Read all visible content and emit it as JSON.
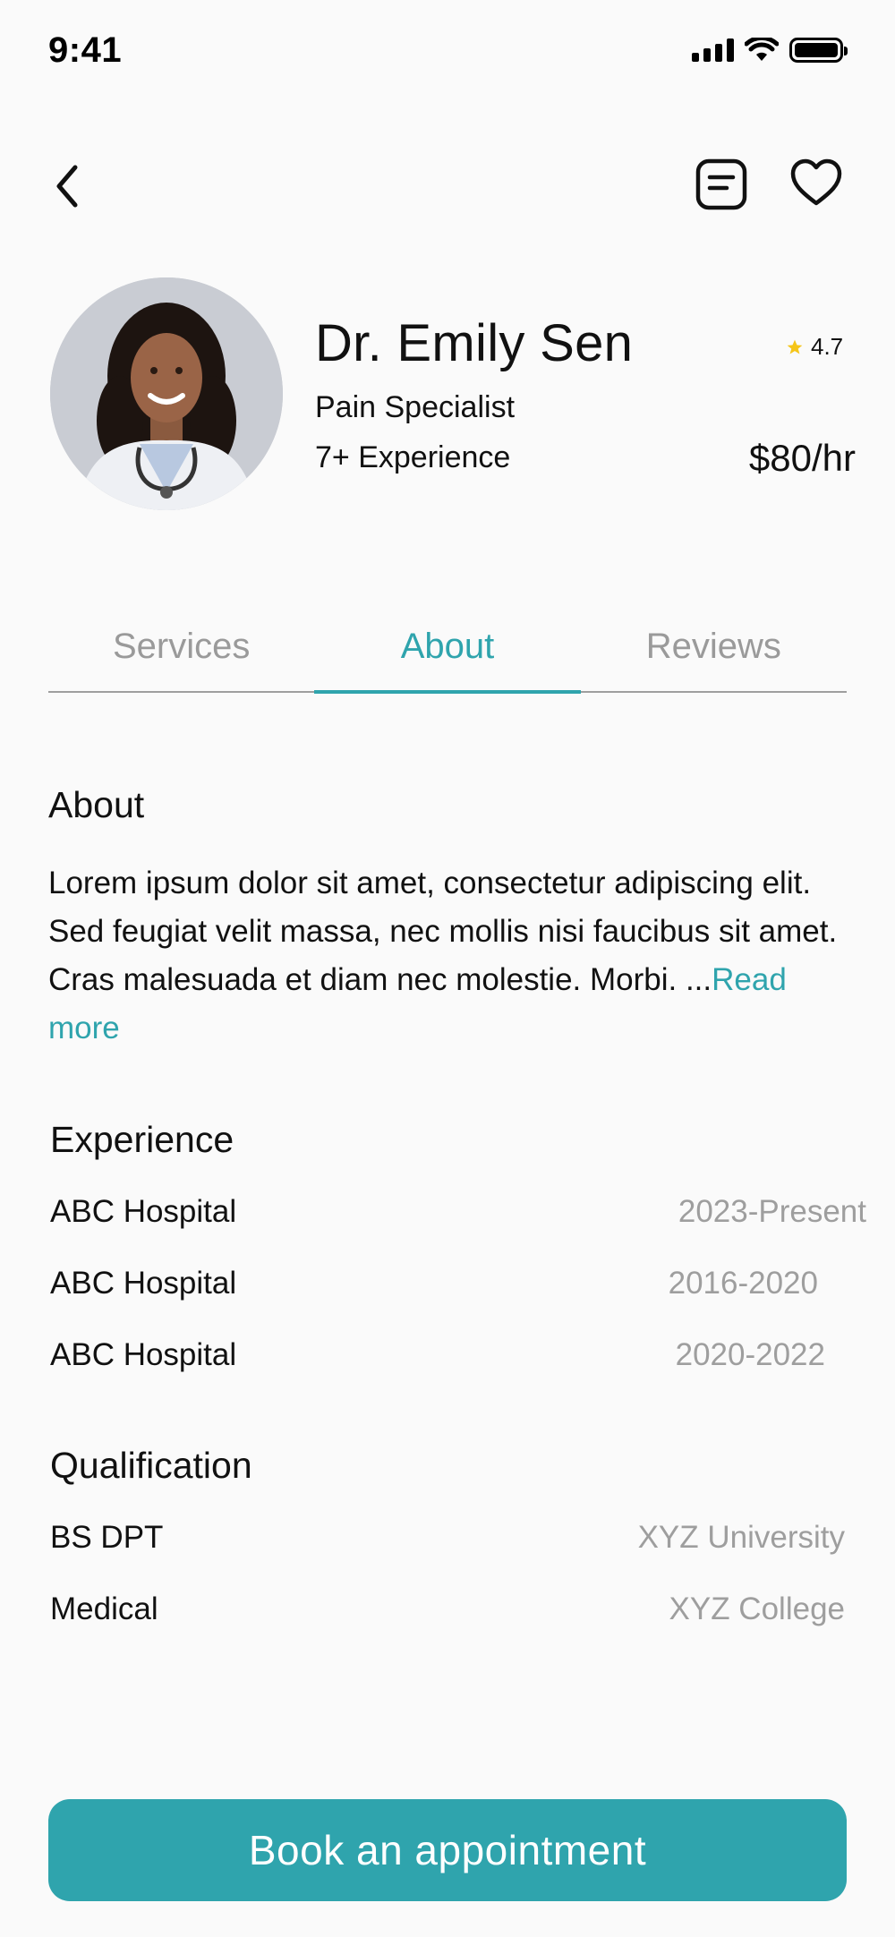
{
  "status_bar": {
    "time": "9:41"
  },
  "doctor": {
    "name": "Dr. Emily Sen",
    "rating": "4.7",
    "specialty": "Pain Specialist",
    "experience": "7+ Experience",
    "price": "$80/hr"
  },
  "tabs": [
    {
      "label": "Services",
      "active": false
    },
    {
      "label": "About",
      "active": true
    },
    {
      "label": "Reviews",
      "active": false
    }
  ],
  "about": {
    "title": "About",
    "text": "Lorem ipsum dolor sit amet, consectetur adipiscing elit. Sed feugiat velit massa, nec mollis nisi faucibus sit amet. Cras malesuada et diam nec molestie. Morbi. ...",
    "read_more": "Read more"
  },
  "experience": {
    "title": "Experience",
    "items": [
      {
        "place": "ABC Hospital",
        "period": "2023-Present"
      },
      {
        "place": "ABC Hospital",
        "period": "2016-2020"
      },
      {
        "place": "ABC Hospital",
        "period": "2020-2022"
      }
    ]
  },
  "qualification": {
    "title": "Qualification",
    "items": [
      {
        "degree": "BS DPT",
        "institution": "XYZ University"
      },
      {
        "degree": "Medical",
        "institution": "XYZ College"
      }
    ]
  },
  "actions": {
    "book_label": "Book an appointment"
  },
  "colors": {
    "accent": "#2fa4ad",
    "star": "#f5c518",
    "muted": "#9e9e9e"
  },
  "icons": [
    "back-chevron-icon",
    "notes-icon",
    "heart-icon",
    "star-icon"
  ]
}
